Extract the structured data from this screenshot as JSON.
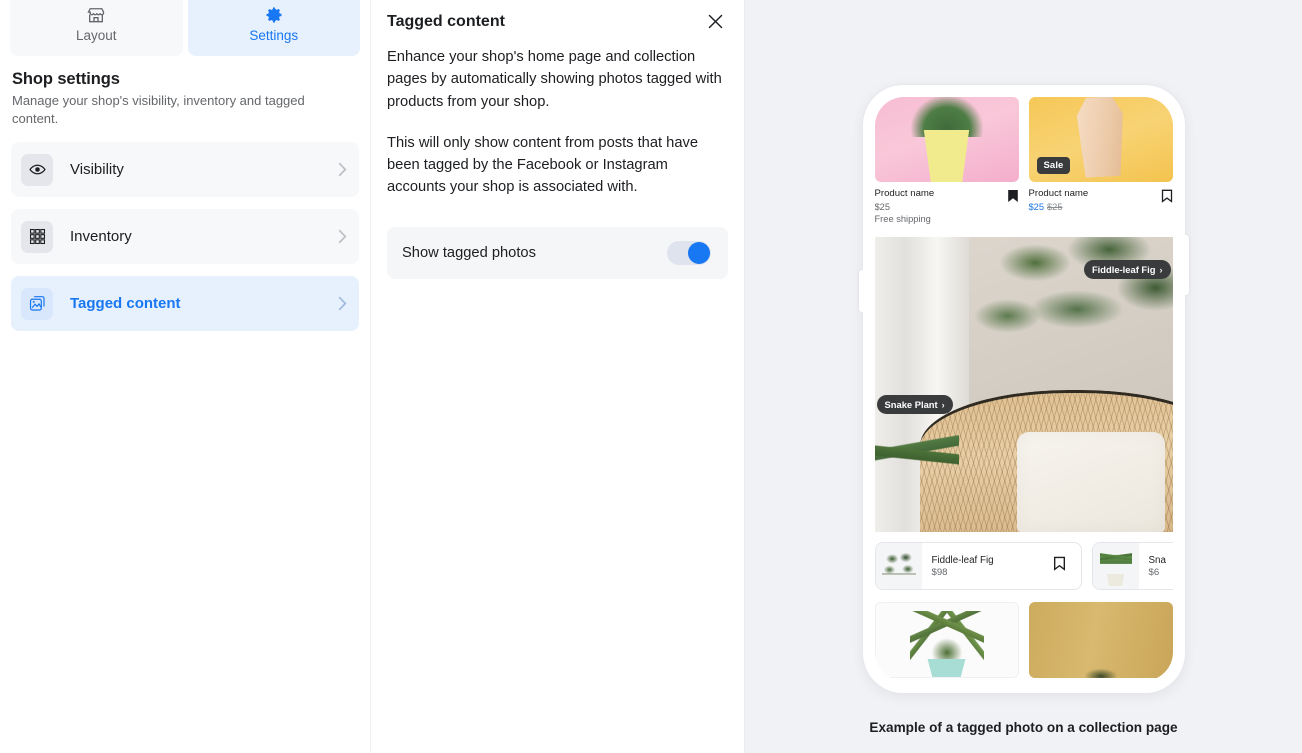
{
  "tabs": [
    {
      "label": "Layout",
      "icon": "storefront-icon",
      "active": false
    },
    {
      "label": "Settings",
      "icon": "gear-icon",
      "active": true
    }
  ],
  "shop_settings": {
    "title": "Shop settings",
    "subtitle": "Manage your shop's visibility, inventory and tagged content."
  },
  "nav": {
    "items": [
      {
        "label": "Visibility",
        "icon": "eye-icon",
        "selected": false
      },
      {
        "label": "Inventory",
        "icon": "grid-icon",
        "selected": false
      },
      {
        "label": "Tagged content",
        "icon": "photo-stack-icon",
        "selected": true
      }
    ],
    "chevron": "›"
  },
  "detail": {
    "title": "Tagged content",
    "close_icon": "close-icon",
    "paragraph_1": "Enhance your shop's home page and collection pages by automatically showing photos tagged with products from your shop.",
    "paragraph_2": "This will only show content from posts that have been tagged by the Facebook or Instagram accounts your shop is associated with.",
    "toggle": {
      "label": "Show tagged photos",
      "state": "on"
    }
  },
  "preview": {
    "caption": "Example of a tagged photo on a collection page",
    "top_products": [
      {
        "name": "Product name",
        "price": "$25",
        "shipping": "Free shipping",
        "badge": "",
        "saved": true
      },
      {
        "name": "Product name",
        "sale_price": "$25",
        "original_price": "$25",
        "badge": "Sale",
        "saved": false
      }
    ],
    "photo_tags": [
      {
        "label": "Fiddle-leaf Fig",
        "arrow": "›"
      },
      {
        "label": "Snake Plant",
        "arrow": "›"
      }
    ],
    "carousel": [
      {
        "name": "Fiddle-leaf Fig",
        "price": "$98",
        "saved": false
      },
      {
        "name": "Sna",
        "price": "$6",
        "saved": false
      }
    ]
  },
  "colors": {
    "accent": "#1877f2",
    "accent_tint": "#e7f0fd",
    "panel_bg": "#f0f2f5",
    "row_bg": "#f7f8fa",
    "text": "#1c1e21",
    "text_muted": "#65676b",
    "badge_dark": "#3a3b3c",
    "sale_price": "#1b74e4"
  }
}
